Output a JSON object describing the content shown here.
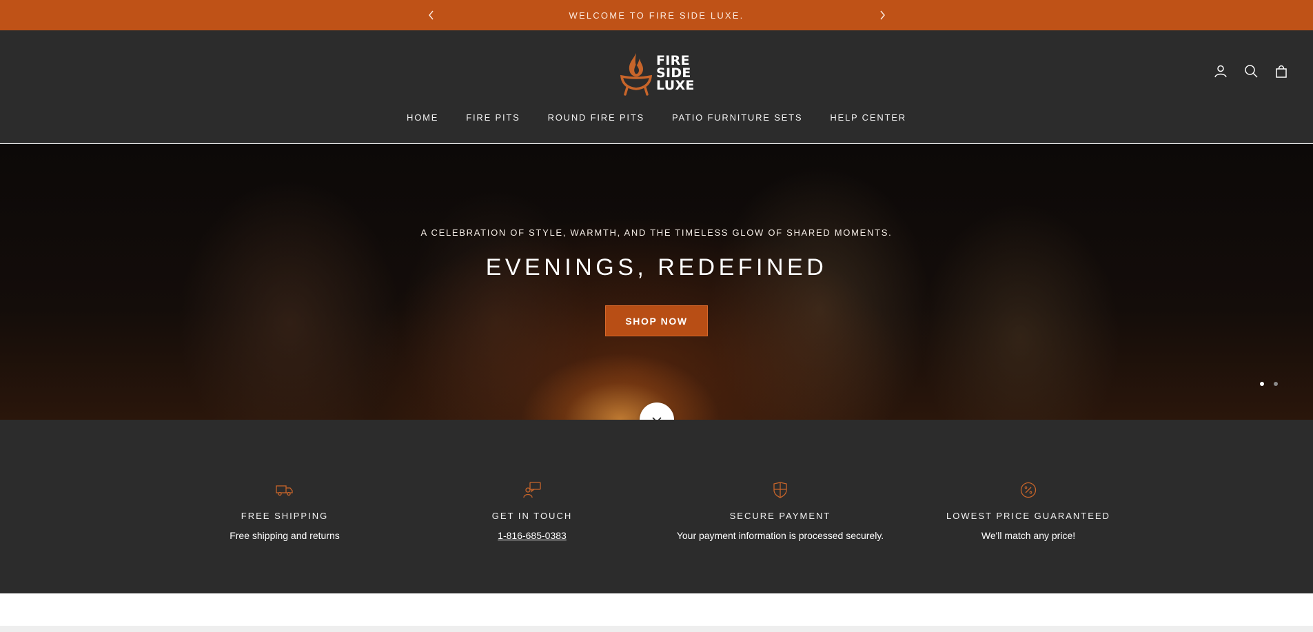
{
  "announcement": {
    "text": "WELCOME TO FIRE SIDE LUXE.",
    "prev_icon": "chevron-left-icon",
    "next_icon": "chevron-right-icon"
  },
  "logo": {
    "lines": [
      "FIRE",
      "SIDE",
      "LUXE"
    ],
    "icon": "flame-bowl-icon"
  },
  "header_icons": [
    "account-icon",
    "search-icon",
    "cart-icon"
  ],
  "nav": {
    "items": [
      "HOME",
      "FIRE PITS",
      "ROUND FIRE PITS",
      "PATIO FURNITURE SETS",
      "HELP CENTER"
    ]
  },
  "hero": {
    "subtitle": "A CELEBRATION OF STYLE, WARMTH, AND THE TIMELESS GLOW OF SHARED MOMENTS.",
    "title": "EVENINGS, REDEFINED",
    "button_label": "SHOP NOW",
    "slides_total": 2,
    "active_slide": 1,
    "scroll_icon": "chevron-down-icon"
  },
  "features": [
    {
      "icon": "truck-icon",
      "title": "FREE SHIPPING",
      "text": "Free shipping and returns"
    },
    {
      "icon": "chat-support-icon",
      "title": "GET IN TOUCH",
      "text": "1-816-685-0383"
    },
    {
      "icon": "shield-icon",
      "title": "SECURE PAYMENT",
      "text": "Your payment information is processed securely."
    },
    {
      "icon": "percent-badge-icon",
      "title": "LOWEST PRICE GUARANTEED",
      "text": "We'll match any price!"
    }
  ],
  "colors": {
    "accent": "#bf5217",
    "header_bg": "#2c2c2c",
    "icon_orange": "#c8652a"
  }
}
